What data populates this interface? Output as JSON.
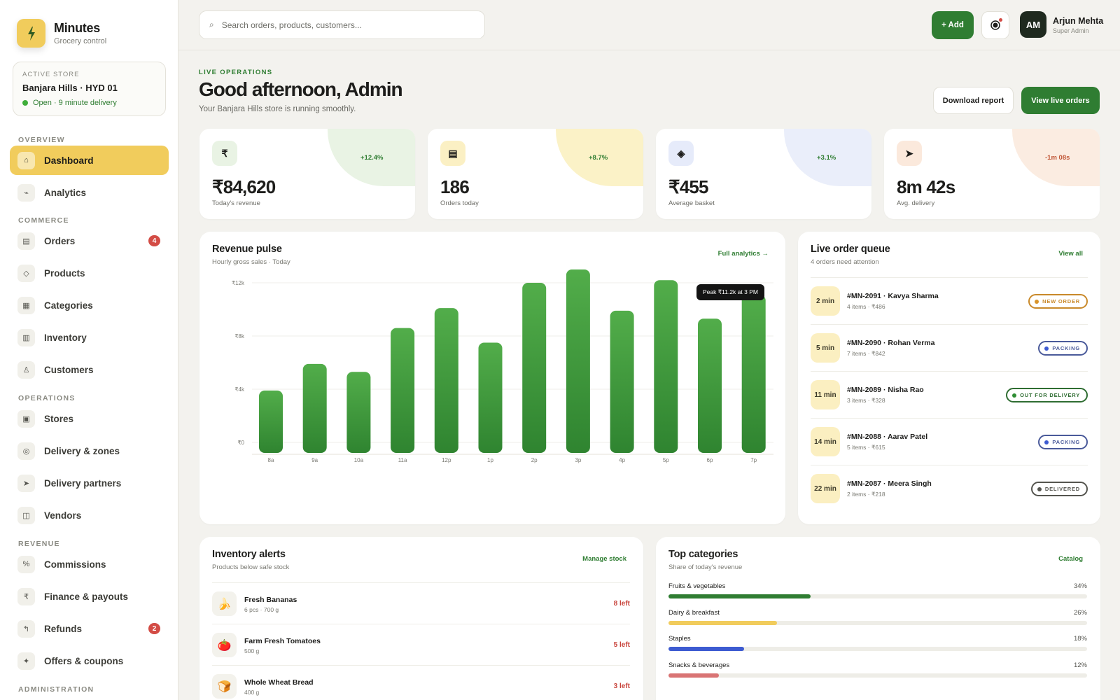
{
  "brand": {
    "name": "Minutes",
    "subtitle": "Grocery control"
  },
  "store": {
    "label": "ACTIVE STORE",
    "name": "Banjara Hills · HYD 01",
    "status": "Open · 9 minute delivery"
  },
  "nav": {
    "sections": [
      "OVERVIEW",
      "COMMERCE",
      "OPERATIONS",
      "REVENUE",
      "ADMINISTRATION"
    ],
    "items": [
      {
        "label": "Dashboard",
        "icon": "home-icon",
        "glyph": "⌂",
        "active": true
      },
      {
        "label": "Analytics",
        "icon": "analytics-icon",
        "glyph": "⌁"
      },
      {
        "label": "Orders",
        "icon": "orders-icon",
        "glyph": "▤",
        "badge": "4"
      },
      {
        "label": "Products",
        "icon": "products-icon",
        "glyph": "◇"
      },
      {
        "label": "Categories",
        "icon": "categories-icon",
        "glyph": "▦"
      },
      {
        "label": "Inventory",
        "icon": "inventory-icon",
        "glyph": "▥"
      },
      {
        "label": "Customers",
        "icon": "customers-icon",
        "glyph": "♙"
      },
      {
        "label": "Stores",
        "icon": "stores-icon",
        "glyph": "▣"
      },
      {
        "label": "Delivery & zones",
        "icon": "zones-icon",
        "glyph": "◎"
      },
      {
        "label": "Delivery partners",
        "icon": "partners-icon",
        "glyph": "➤"
      },
      {
        "label": "Vendors",
        "icon": "vendors-icon",
        "glyph": "◫"
      },
      {
        "label": "Commissions",
        "icon": "commissions-icon",
        "glyph": "%"
      },
      {
        "label": "Finance & payouts",
        "icon": "finance-icon",
        "glyph": "₹"
      },
      {
        "label": "Refunds",
        "icon": "refunds-icon",
        "glyph": "↰",
        "badge": "2"
      },
      {
        "label": "Offers & coupons",
        "icon": "offers-icon",
        "glyph": "✦"
      }
    ]
  },
  "topbar": {
    "search_placeholder": "Search orders, products, customers...",
    "add_label": "+ Add",
    "user": {
      "initials": "AM",
      "name": "Arjun Mehta",
      "role": "Super Admin"
    }
  },
  "header": {
    "eyebrow": "LIVE OPERATIONS",
    "title": "Good afternoon, Admin",
    "subtitle": "Your Banjara Hills store is running smoothly.",
    "download_label": "Download report",
    "live_label": "View live orders"
  },
  "kpis": [
    {
      "icon": "rupee-icon",
      "glyph": "₹",
      "delta": "+12.4%",
      "value": "₹84,620",
      "label": "Today's revenue",
      "blob": "#e9f3e4",
      "icon_bg": "#e9f3e4",
      "delta_color": "#2f7d32"
    },
    {
      "icon": "orders-icon",
      "glyph": "▤",
      "delta": "+8.7%",
      "value": "186",
      "label": "Orders today",
      "blob": "#fbf2c7",
      "icon_bg": "#fbf0c4",
      "delta_color": "#2f7d32"
    },
    {
      "icon": "basket-icon",
      "glyph": "◈",
      "delta": "+3.1%",
      "value": "₹455",
      "label": "Average basket",
      "blob": "#eaeefa",
      "icon_bg": "#e6ebfa",
      "delta_color": "#2f7d32"
    },
    {
      "icon": "delivery-icon",
      "glyph": "➤",
      "delta": "-1m 08s",
      "value": "8m 42s",
      "label": "Avg. delivery",
      "blob": "#fbece1",
      "icon_bg": "#fbe9dc",
      "delta_color": "#c2593a"
    }
  ],
  "revenue": {
    "title": "Revenue pulse",
    "subtitle": "Hourly gross sales · Today",
    "link": "Full analytics →",
    "tooltip": "Peak ₹11.2k at 3 PM"
  },
  "chart_data": {
    "type": "bar",
    "categories": [
      "8a",
      "9a",
      "10a",
      "11a",
      "12p",
      "1p",
      "2p",
      "3p",
      "4p",
      "5p",
      "6p",
      "7p"
    ],
    "values": [
      3.9,
      5.9,
      5.3,
      8.6,
      10.1,
      7.5,
      12.0,
      13.0,
      9.9,
      12.2,
      9.3,
      11.1
    ],
    "y_ticks": [
      0,
      4,
      8,
      12
    ],
    "y_tick_labels": [
      "₹0",
      "₹4k",
      "₹8k",
      "₹12k"
    ],
    "ylim": [
      0,
      13.5
    ],
    "bar_color": "#3d9b3a",
    "grid": true
  },
  "queue": {
    "title": "Live order queue",
    "subtitle": "4 orders need attention",
    "link": "View all",
    "rows": [
      {
        "time": "2 min",
        "title": "#MN-2091 · Kavya Sharma",
        "meta": "4 items · ₹486",
        "status": "NEW ORDER",
        "color": "#c9892a",
        "dot": "#d9952a"
      },
      {
        "time": "5 min",
        "title": "#MN-2090 · Rohan Verma",
        "meta": "7 items · ₹842",
        "status": "PACKING",
        "color": "#4a5a9a",
        "dot": "#3d5bd1"
      },
      {
        "time": "11 min",
        "title": "#MN-2089 · Nisha Rao",
        "meta": "3 items · ₹328",
        "status": "OUT FOR DELIVERY",
        "color": "#2f6d32",
        "dot": "#2f8d34"
      },
      {
        "time": "14 min",
        "title": "#MN-2088 · Aarav Patel",
        "meta": "5 items · ₹615",
        "status": "PACKING",
        "color": "#4a5a9a",
        "dot": "#3d5bd1"
      },
      {
        "time": "22 min",
        "title": "#MN-2087 · Meera Singh",
        "meta": "2 items · ₹218",
        "status": "DELIVERED",
        "color": "#55554f",
        "dot": "#55554f"
      }
    ]
  },
  "inventory": {
    "title": "Inventory alerts",
    "subtitle": "Products below safe stock",
    "link": "Manage stock",
    "rows": [
      {
        "emoji": "🍌",
        "name": "Fresh Bananas",
        "meta": "6 pcs · 700 g",
        "left": "8 left"
      },
      {
        "emoji": "🍅",
        "name": "Farm Fresh Tomatoes",
        "meta": "500 g",
        "left": "5 left"
      },
      {
        "emoji": "🍞",
        "name": "Whole Wheat Bread",
        "meta": "400 g",
        "left": "3 left"
      }
    ]
  },
  "categories": {
    "title": "Top categories",
    "subtitle": "Share of today's revenue",
    "link": "Catalog",
    "rows": [
      {
        "name": "Fruits & vegetables",
        "pct": "34%",
        "share": 0.34,
        "color": "#2f7d32"
      },
      {
        "name": "Dairy & breakfast",
        "pct": "26%",
        "share": 0.26,
        "color": "#f1cc5c"
      },
      {
        "name": "Staples",
        "pct": "18%",
        "share": 0.18,
        "color": "#3d5bd1"
      },
      {
        "name": "Snacks & beverages",
        "pct": "12%",
        "share": 0.12,
        "color": "#d97474"
      }
    ]
  }
}
